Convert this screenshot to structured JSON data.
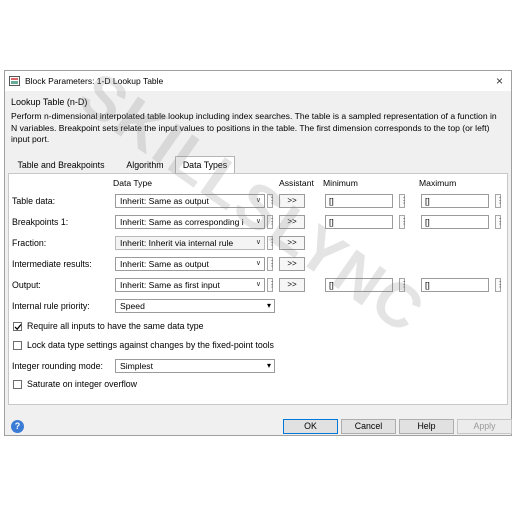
{
  "window": {
    "title": "Block Parameters: 1-D Lookup Table",
    "close_glyph": "×"
  },
  "block": {
    "type_label": "Lookup Table (n-D)",
    "description": "Perform n-dimensional interpolated table lookup including index searches. The table is a sampled representation of a function in N variables. Breakpoint sets relate the input values to positions in the table. The first dimension corresponds to the top (or left) input port."
  },
  "tabs": [
    {
      "label": "Table and Breakpoints",
      "active": false
    },
    {
      "label": "Algorithm",
      "active": false
    },
    {
      "label": "Data Types",
      "active": true
    }
  ],
  "columns": {
    "data_type": "Data Type",
    "assistant": "Assistant",
    "minimum": "Minimum",
    "maximum": "Maximum"
  },
  "rows": [
    {
      "label": "Table data:",
      "type": "Inherit: Same as output",
      "assistant": ">>",
      "min": "[]",
      "max": "[]"
    },
    {
      "label": "Breakpoints 1:",
      "type": "Inherit: Same as corresponding i",
      "assistant": ">>",
      "min": "[]",
      "max": "[]"
    },
    {
      "label": "Fraction:",
      "type": "Inherit: Inherit via internal rule",
      "assistant": ">>"
    },
    {
      "label": "Intermediate results:",
      "type": "Inherit: Same as output",
      "assistant": ">>"
    },
    {
      "label": "Output:",
      "type": "Inherit: Same as first input",
      "assistant": ">>",
      "min": "[]",
      "max": "[]"
    }
  ],
  "internal_rule": {
    "label": "Internal rule priority:",
    "value": "Speed"
  },
  "checkboxes": {
    "require_same_type": {
      "label": "Require all inputs to have the same data type",
      "checked": true
    },
    "lock_data_type": {
      "label": "Lock data type settings against changes by the fixed-point tools",
      "checked": false
    },
    "saturate": {
      "label": "Saturate on integer overflow",
      "checked": false
    }
  },
  "rounding": {
    "label": "Integer rounding mode:",
    "value": "Simplest"
  },
  "buttons": {
    "ok": "OK",
    "cancel": "Cancel",
    "help": "Help",
    "apply": "Apply",
    "help_icon_glyph": "?"
  },
  "icons": {
    "dropdown_arrow": "∨",
    "kebab": "⋮",
    "help_color": "#3a7bd5",
    "accent": "#0078d7"
  },
  "watermark": "SKILLSLYNC"
}
